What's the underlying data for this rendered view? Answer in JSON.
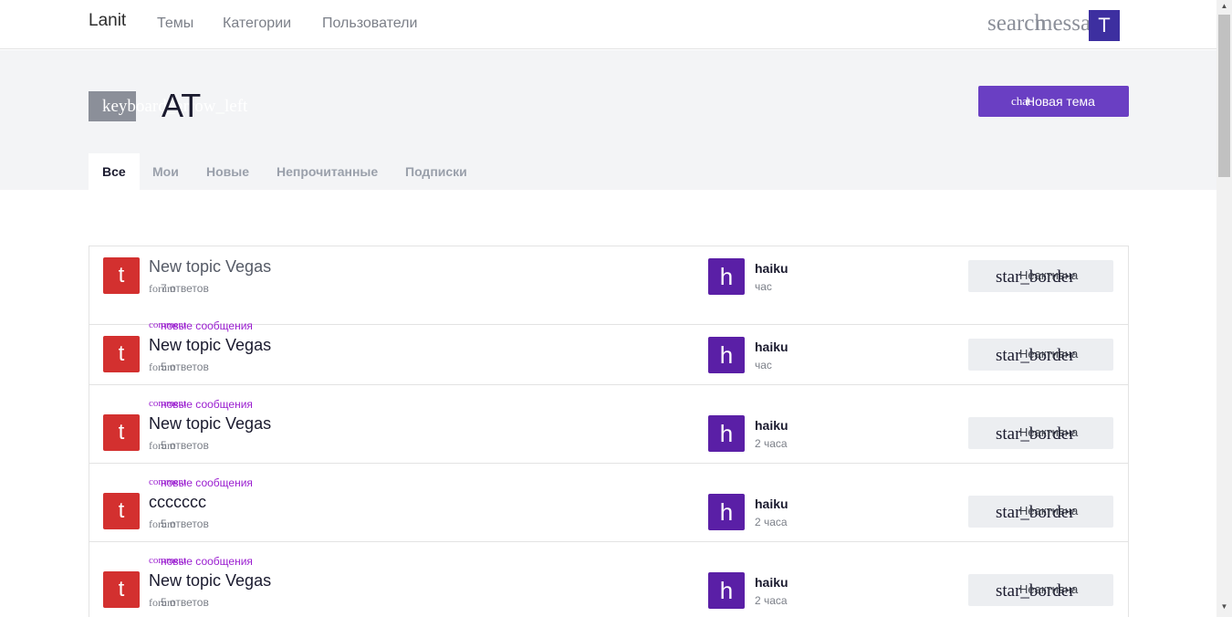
{
  "nav": {
    "brand": "Lanit",
    "links": [
      "Темы",
      "Категории",
      "Пользователи"
    ],
    "search_icon": "search",
    "message_icon": "message",
    "user_initial": "T"
  },
  "header": {
    "back_icon": "keyboard_arrow_left",
    "title": "АТ",
    "new_topic": {
      "icon": "chat",
      "label": "Новая тема"
    }
  },
  "tabs": [
    {
      "label": "Все",
      "active": true
    },
    {
      "label": "Мои",
      "active": false
    },
    {
      "label": "Новые",
      "active": false
    },
    {
      "label": "Непрочитанные",
      "active": false
    },
    {
      "label": "Подписки",
      "active": false
    }
  ],
  "topics": [
    {
      "category_initial": "t",
      "new_messages_icon": "",
      "new_messages": "",
      "title": "New topic Vegas",
      "replies_icon": "forum",
      "replies": "7 ответов",
      "author_initial": "h",
      "author": "haiku",
      "time": "час",
      "star_icon": "star_border",
      "star_label": "Неактивна"
    },
    {
      "category_initial": "t",
      "new_messages_icon": "comment",
      "new_messages": "новые сообщения",
      "title": "New topic Vegas",
      "replies_icon": "forum",
      "replies": "5 ответов",
      "author_initial": "h",
      "author": "haiku",
      "time": "час",
      "star_icon": "star_border",
      "star_label": "Неактивна"
    },
    {
      "category_initial": "t",
      "new_messages_icon": "comment",
      "new_messages": "новые сообщения",
      "title": "New topic Vegas",
      "replies_icon": "forum",
      "replies": "5 ответов",
      "author_initial": "h",
      "author": "haiku",
      "time": "2 часа",
      "star_icon": "star_border",
      "star_label": "Неактивна"
    },
    {
      "category_initial": "t",
      "new_messages_icon": "comment",
      "new_messages": "новые сообщения",
      "title": "ccccccc",
      "replies_icon": "forum",
      "replies": "5 ответов",
      "author_initial": "h",
      "author": "haiku",
      "time": "2 часа",
      "star_icon": "star_border",
      "star_label": "Неактивна"
    },
    {
      "category_initial": "t",
      "new_messages_icon": "comment",
      "new_messages": "новые сообщения",
      "title": "New topic Vegas",
      "replies_icon": "forum",
      "replies": "5 ответов",
      "author_initial": "h",
      "author": "haiku",
      "time": "2 часа",
      "star_icon": "star_border",
      "star_label": "Неактивна"
    }
  ],
  "colors": {
    "accent": "#6a3fc3",
    "category": "#d3302f",
    "author_avatar": "#5a1fa6",
    "new_messages": "#9b1fd0"
  }
}
